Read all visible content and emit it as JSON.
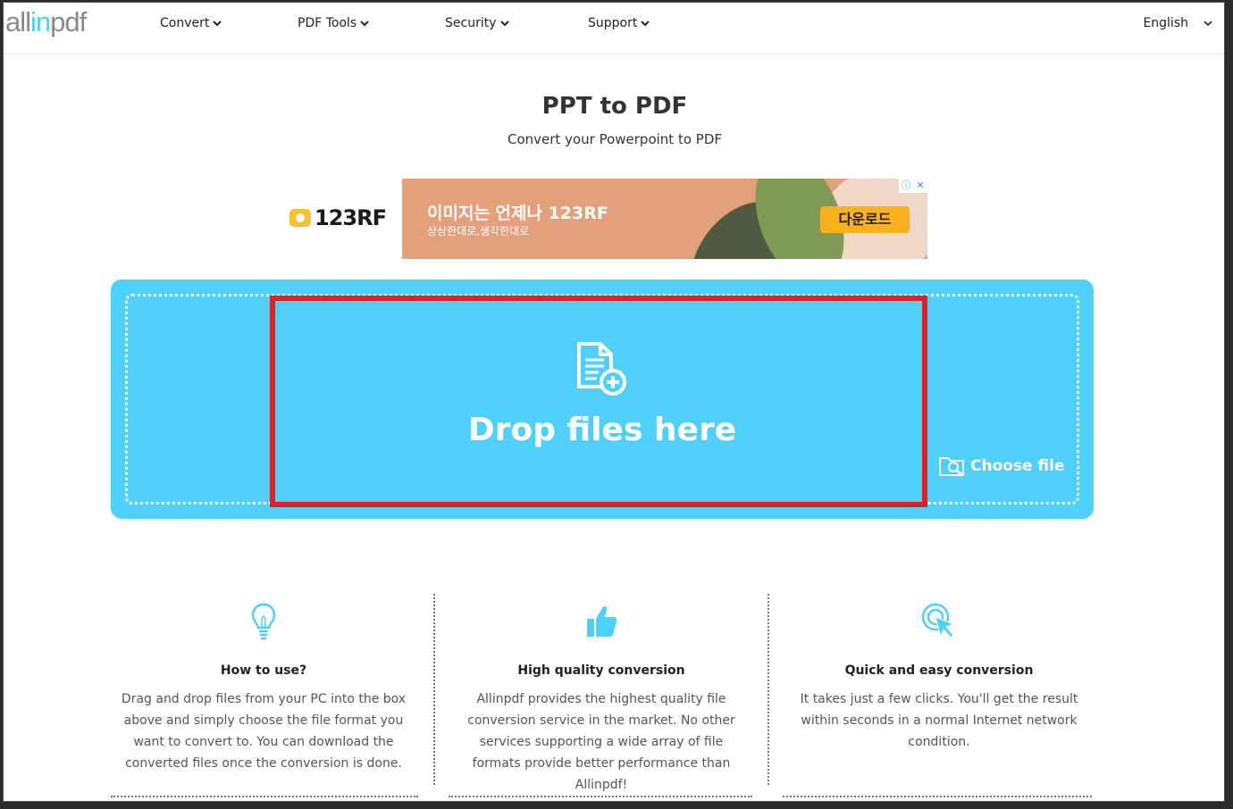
{
  "header": {
    "logo_all": "all",
    "logo_in": "in",
    "logo_pdf": "pdf",
    "nav": [
      "Convert",
      "PDF Tools",
      "Security",
      "Support"
    ],
    "language": "English"
  },
  "page": {
    "title": "PPT to PDF",
    "subtitle": "Convert your Powerpoint to PDF"
  },
  "ad": {
    "brand": "123RF",
    "headline": "이미지는 언제나 123RF",
    "subline": "상상한대로,생각한대로",
    "button": "다운로드",
    "info_icon": "ⓘ",
    "close_icon": "✕"
  },
  "dropzone": {
    "drop_text": "Drop files here",
    "choose_label": "Choose file"
  },
  "features": [
    {
      "icon": "lightbulb-icon",
      "title": "How to use?",
      "text": "Drag and drop files from your PC into the box above and simply choose the file format you want to convert to. You can download the converted files once the conversion is done."
    },
    {
      "icon": "thumbs-up-icon",
      "title": "High quality conversion",
      "text": "Allinpdf provides the highest quality file conversion service in the market. No other services supporting a wide array of file formats provide better performance than Allinpdf!"
    },
    {
      "icon": "click-cursor-icon",
      "title": "Quick and easy conversion",
      "text": "It takes just a few clicks. You'll get the result within seconds in a normal Internet network condition."
    }
  ],
  "colors": {
    "accent": "#4fd0fb",
    "highlight": "#e31e24"
  }
}
